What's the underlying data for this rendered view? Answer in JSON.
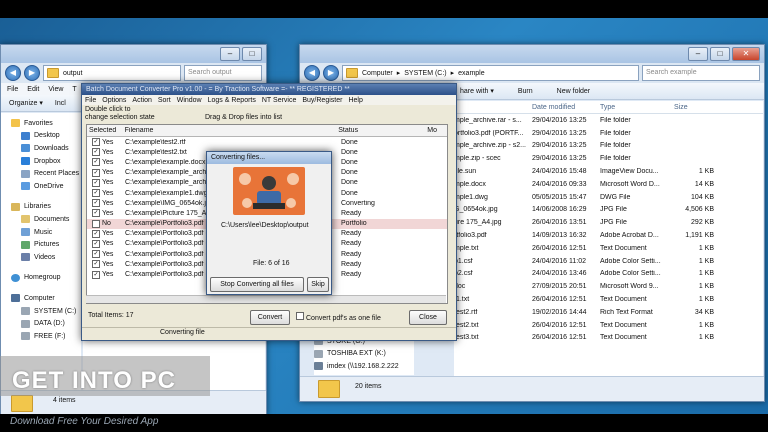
{
  "left_explorer": {
    "address": "output",
    "search_placeholder": "Search output",
    "menu": [
      "File",
      "Edit",
      "View",
      "T"
    ],
    "toolbar": [
      "Organize ▾",
      "Incl"
    ],
    "nav": {
      "favorites": "Favorites",
      "favorites_items": [
        "Desktop",
        "Downloads",
        "Dropbox",
        "Recent Places",
        "OneDrive"
      ],
      "libraries": "Libraries",
      "libraries_items": [
        "Documents",
        "Music",
        "Pictures",
        "Videos"
      ],
      "homegroup": "Homegroup",
      "computer": "Computer",
      "computer_items": [
        "SYSTEM (C:)",
        "DATA (D:)",
        "FREE (F:)"
      ]
    },
    "status": "4 items"
  },
  "right_explorer": {
    "breadcrumb": [
      "Computer",
      "SYSTEM (C:)",
      "example"
    ],
    "search_placeholder": "Search example",
    "toolbar": [
      "hare with ▾",
      "Burn",
      "New folder"
    ],
    "columns": [
      "Date modified",
      "Type",
      "Size"
    ],
    "rows": [
      {
        "name": "mple_archive.rar - s...",
        "date": "29/04/2016 13:25",
        "type": "File folder",
        "size": ""
      },
      {
        "name": "ortfolio3.pdf (PORTF...",
        "date": "29/04/2016 13:25",
        "type": "File folder",
        "size": ""
      },
      {
        "name": "mple_archive.zip - s2...",
        "date": "29/04/2016 13:25",
        "type": "File folder",
        "size": ""
      },
      {
        "name": "mple.zip - scec",
        "date": "29/04/2016 13:25",
        "type": "File folder",
        "size": ""
      },
      {
        "name": "file.sun",
        "date": "24/04/2016 15:48",
        "type": "ImageView Docu...",
        "size": "1 KB"
      },
      {
        "name": "mple.docx",
        "date": "24/04/2016 09:33",
        "type": "Microsoft Word D...",
        "size": "14 KB"
      },
      {
        "name": "mple1.dwg",
        "date": "05/05/2015 15:47",
        "type": "DWG File",
        "size": "104 KB"
      },
      {
        "name": "G_0654ok.jpg",
        "date": "14/06/2008 16:29",
        "type": "JPG File",
        "size": "4,506 KB"
      },
      {
        "name": "ure 175_A4.jpg",
        "date": "26/04/2016 13:51",
        "type": "JPG File",
        "size": "292 KB"
      },
      {
        "name": "rtfolio3.pdf",
        "date": "14/09/2013 16:32",
        "type": "Adobe Acrobat D...",
        "size": "1,191 KB"
      },
      {
        "name": "mple.txt",
        "date": "26/04/2016 12:51",
        "type": "Text Document",
        "size": "1 KB"
      },
      {
        "name": "p1.csf",
        "date": "24/04/2016 11:02",
        "type": "Adobe Color Setti...",
        "size": "1 KB"
      },
      {
        "name": "p2.csf",
        "date": "24/04/2016 13:46",
        "type": "Adobe Color Setti...",
        "size": "1 KB"
      },
      {
        "name": "doc",
        "date": "27/09/2015 20:51",
        "type": "Microsoft Word 9...",
        "size": "1 KB"
      },
      {
        "name": "t1.txt",
        "date": "26/04/2016 12:51",
        "type": "Text Document",
        "size": "1 KB"
      },
      {
        "name": "test2.rtf",
        "date": "19/02/2016 14:44",
        "type": "Rich Text Format",
        "size": "34 KB"
      },
      {
        "name": "test2.txt",
        "date": "26/04/2016 12:51",
        "type": "Text Document",
        "size": "1 KB"
      },
      {
        "name": "test3.txt",
        "date": "26/04/2016 12:51",
        "type": "Text Document",
        "size": "1 KB"
      }
    ],
    "drives": [
      "STORE (G:)",
      "TOSHIBA EXT (K:)",
      "imdex (\\\\192.168.2.222"
    ],
    "status": "20 items"
  },
  "app": {
    "title": "Batch Document Converter Pro v1.00 - = By Traction Software =- ** REGISTERED **",
    "menu": [
      "File",
      "Options",
      "Action",
      "Sort",
      "Window",
      "Logs & Reports",
      "NT Service",
      "Buy/Register",
      "Help"
    ],
    "hint_left": "Double click to change selection state",
    "hint_right": "Drag & Drop files into list",
    "columns": {
      "selected": "Selected",
      "filename": "Filename",
      "status": "Status",
      "more": "Mo"
    },
    "rows": [
      {
        "sel": "Yes",
        "file": "C:\\example\\test2.rtf",
        "status": "Done"
      },
      {
        "sel": "Yes",
        "file": "C:\\example\\test2.txt",
        "status": "Done"
      },
      {
        "sel": "Yes",
        "file": "C:\\example\\example.docx",
        "status": "Done"
      },
      {
        "sel": "Yes",
        "file": "C:\\example\\example_archive",
        "status": "Done"
      },
      {
        "sel": "Yes",
        "file": "C:\\example\\example_archive",
        "status": "Done"
      },
      {
        "sel": "Yes",
        "file": "C:\\example\\example1.dwg",
        "status": "Done"
      },
      {
        "sel": "Yes",
        "file": "C:\\example\\IMG_0654ok.jpg",
        "status": "Converting"
      },
      {
        "sel": "Yes",
        "file": "C:\\example\\Picture 175_A4.j",
        "status": "Ready"
      },
      {
        "sel": "No",
        "file": "C:\\example\\Portfolio3.pdf",
        "status": "Portfolio"
      },
      {
        "sel": "Yes",
        "file": "C:\\example\\Portfolio3.pdf (P",
        "status": "Ready"
      },
      {
        "sel": "Yes",
        "file": "C:\\example\\Portfolio3.pdf (P",
        "status": "Ready"
      },
      {
        "sel": "Yes",
        "file": "C:\\example\\Portfolio3.pdf (P",
        "status": "Ready"
      },
      {
        "sel": "Yes",
        "file": "C:\\example\\Portfolio3.pdf (P",
        "status": "Ready"
      },
      {
        "sel": "Yes",
        "file": "C:\\example\\Portfolio3.pdf (P",
        "status": "Ready"
      }
    ],
    "total_items": "Total Items:  17",
    "convert": "Convert",
    "convert_pdfs": "Convert pdf's as one file",
    "close": "Close",
    "status": "Converting file"
  },
  "dialog": {
    "title": "Converting files...",
    "path": "C:\\Users\\lee\\Desktop\\output",
    "progress": "File: 6 of 16",
    "stop": "Stop Converting all files",
    "skip": "Skip"
  },
  "watermark": {
    "title": "GET INTO PC",
    "subtitle": "Download Free Your Desired App"
  }
}
